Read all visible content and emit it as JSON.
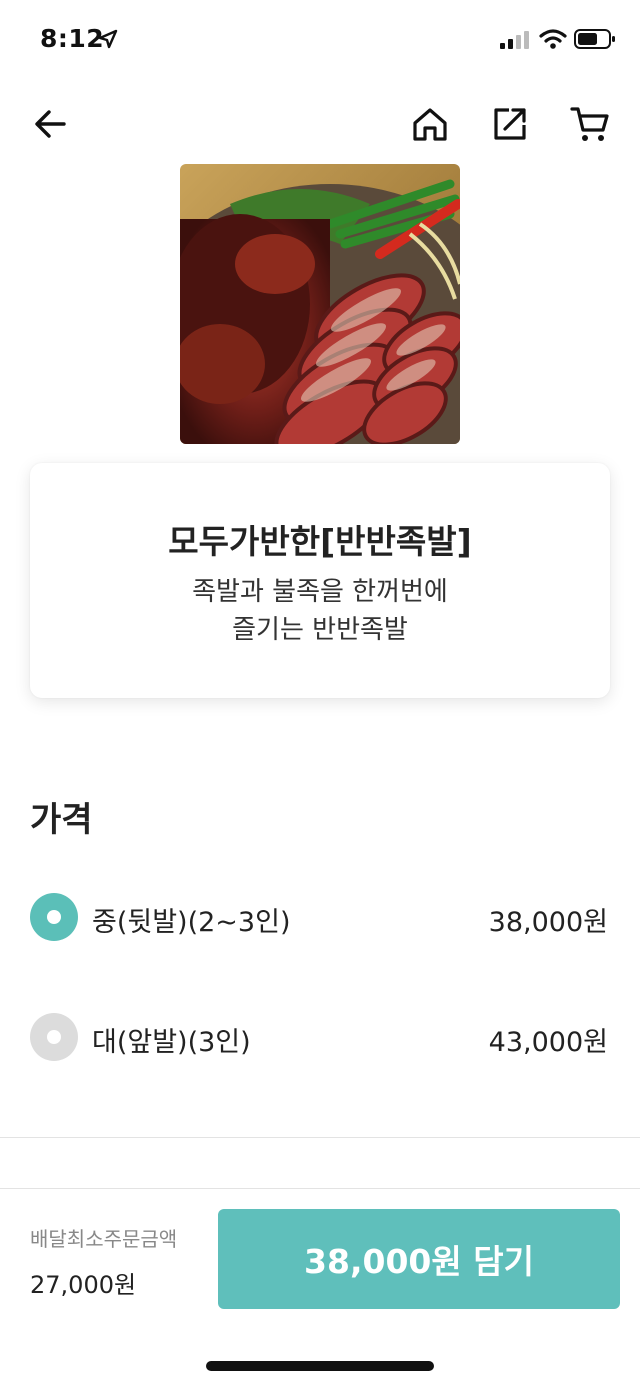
{
  "status_bar": {
    "time": "8:12",
    "icons": [
      "location-arrow-icon",
      "cellular-signal-icon",
      "wifi-icon",
      "battery-icon"
    ]
  },
  "nav": {
    "icons": [
      "back-arrow-icon",
      "home-icon",
      "share-icon",
      "cart-icon"
    ]
  },
  "menu": {
    "title": "모두가반한[반반족발]",
    "description_line1": "족발과 불족을 한꺼번에",
    "description_line2": "즐기는 반반족발"
  },
  "price_section": {
    "title": "가격",
    "options": [
      {
        "label": "중(뒷발)(2~3인)",
        "price": "38,000원",
        "selected": true
      },
      {
        "label": "대(앞발)(3인)",
        "price": "43,000원",
        "selected": false
      }
    ]
  },
  "bottom_bar": {
    "min_order_label": "배달최소주문금액",
    "min_order_value": "27,000원",
    "add_button_label": "38,000원 담기"
  },
  "colors": {
    "accent": "#5fbfbb",
    "radio_unselected": "#dcdcdc"
  }
}
